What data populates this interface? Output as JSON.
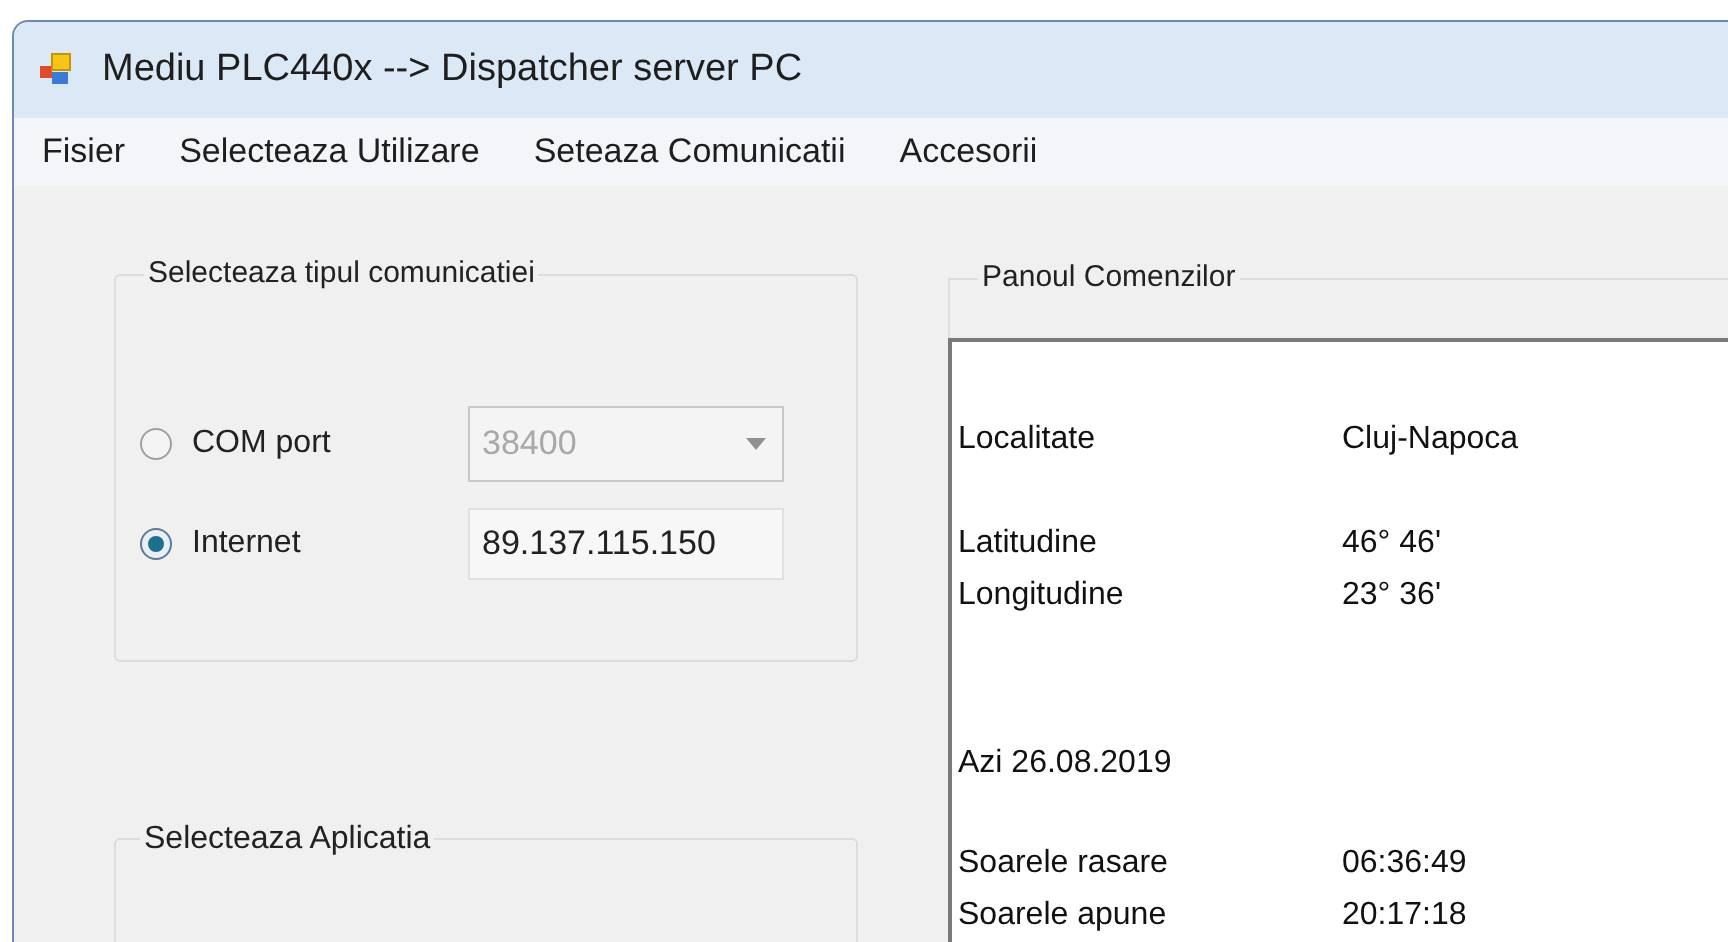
{
  "window": {
    "title": "Mediu PLC440x --> Dispatcher server PC"
  },
  "menu": [
    "Fisier",
    "Selecteaza Utilizare",
    "Seteaza Comunicatii",
    "Accesorii"
  ],
  "communication_group": {
    "title": "Selecteaza tipul comunicatiei",
    "options": [
      {
        "label": "COM port",
        "selected": false,
        "kind": "dropdown",
        "value": "38400",
        "disabled": true
      },
      {
        "label": "Internet",
        "selected": true,
        "kind": "textbox",
        "value": "89.137.115.150",
        "disabled": false
      }
    ]
  },
  "application_group": {
    "title": "Selecteaza Aplicatia"
  },
  "command_panel": {
    "title": "Panoul Comenzilor",
    "blocks": [
      [
        {
          "label": "Localitate",
          "value": "Cluj-Napoca"
        }
      ],
      [
        {
          "label": "Latitudine",
          "value": "46° 46'"
        },
        {
          "label": "Longitudine",
          "value": "23° 36'"
        }
      ],
      [
        {
          "label": "Azi 26.08.2019"
        }
      ],
      [
        {
          "label": "Soarele rasare",
          "value": "06:36:49"
        },
        {
          "label": "Soarele apune",
          "value": "20:17:18"
        }
      ]
    ]
  }
}
